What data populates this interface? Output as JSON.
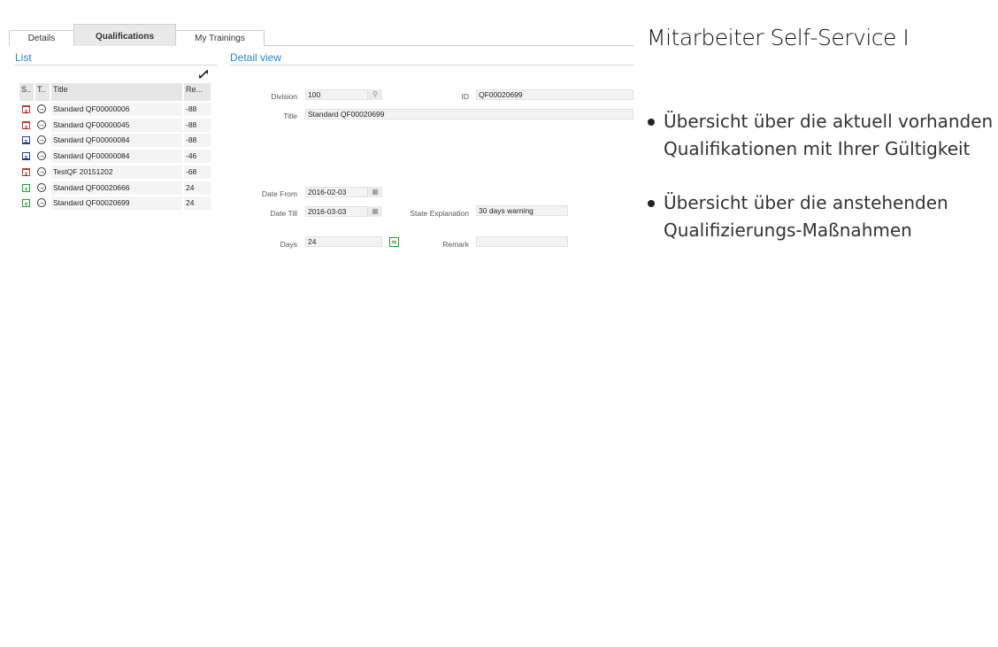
{
  "tabs": [
    {
      "label": "Details",
      "active": false
    },
    {
      "label": "Qualifications",
      "active": true
    },
    {
      "label": "My Trainings",
      "active": false
    }
  ],
  "list": {
    "title": "List",
    "columns": [
      "S..",
      "T..",
      "Title",
      "Re..."
    ],
    "rows": [
      {
        "status": "red",
        "title": "Standard QF00000006",
        "remaining": "-88"
      },
      {
        "status": "red",
        "title": "Standard QF00000045",
        "remaining": "-88"
      },
      {
        "status": "blue",
        "title": "Standard QF00000084",
        "remaining": "-88"
      },
      {
        "status": "blue",
        "title": "Standard QF00000084",
        "remaining": "-46"
      },
      {
        "status": "red",
        "title": "TestQF 20151202",
        "remaining": "-68"
      },
      {
        "status": "green",
        "title": "Standard QF00020666",
        "remaining": "24"
      },
      {
        "status": "green",
        "title": "Standard QF00020699",
        "remaining": "24"
      }
    ]
  },
  "detail": {
    "title": "Detail view",
    "division_label": "Division",
    "division_value": "100",
    "id_label": "ID",
    "id_value": "QF00020699",
    "title_label": "Title",
    "title_value": "Standard QF00020699",
    "date_from_label": "Date From",
    "date_from_value": "2016-02-03",
    "date_till_label": "Date Till",
    "date_till_value": "2016-03-03",
    "state_label": "State Explanation",
    "state_value": "30 days warning",
    "days_label": "Days",
    "days_value": "24",
    "remark_label": "Remark",
    "remark_value": ""
  },
  "slide": {
    "title": "Mitarbeiter Self-Service I",
    "bullets": [
      "Übersicht über die aktuell vorhanden Qualifikationen mit Ihrer Gültigkeit",
      "Übersicht über die anstehenden Qualifizierungs-Maßnahmen"
    ]
  },
  "colors": {
    "accent": "#2a86c9",
    "status_red": "#c0392b",
    "status_blue": "#1f3f9f",
    "status_green": "#2d9b2d"
  }
}
